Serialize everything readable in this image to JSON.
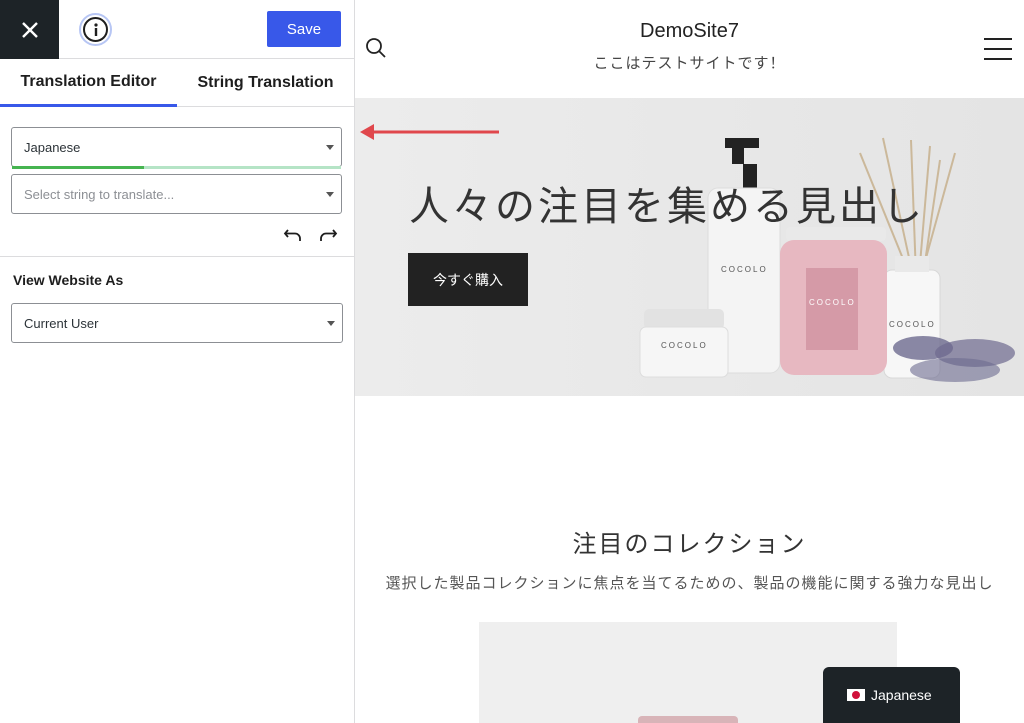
{
  "editor": {
    "save_label": "Save",
    "tabs": [
      {
        "label": "Translation Editor",
        "active": true
      },
      {
        "label": "String Translation",
        "active": false
      }
    ],
    "language_select": {
      "value": "Japanese",
      "progress_fraction": 0.4
    },
    "string_select": {
      "placeholder": "Select string to translate..."
    },
    "view_as": {
      "label": "View Website As",
      "value": "Current User"
    },
    "colors": {
      "accent": "#3858e9",
      "dark": "#1d2327",
      "progress": "#46b450"
    },
    "icons": [
      "close-icon",
      "info-icon",
      "undo-icon",
      "redo-icon",
      "chevron-down-icon"
    ]
  },
  "site": {
    "title": "DemoSite7",
    "tagline": "ここはテストサイトです！",
    "hero": {
      "heading": "人々の注目を集める見出し",
      "button": "今すぐ購入",
      "product_labels": [
        "COCOLO",
        "COCOLO",
        "COCOLO",
        "COCOLO"
      ]
    },
    "collection": {
      "title": "注目のコレクション",
      "description": "選択した製品コレクションに焦点を当てるための、製品の機能に関する強力な見出し"
    },
    "language_switcher": {
      "label": "Japanese"
    },
    "icons": [
      "search-icon",
      "hamburger-menu-icon",
      "japan-flag-icon"
    ]
  },
  "annotation": {
    "arrow_color": "#e0474c"
  }
}
